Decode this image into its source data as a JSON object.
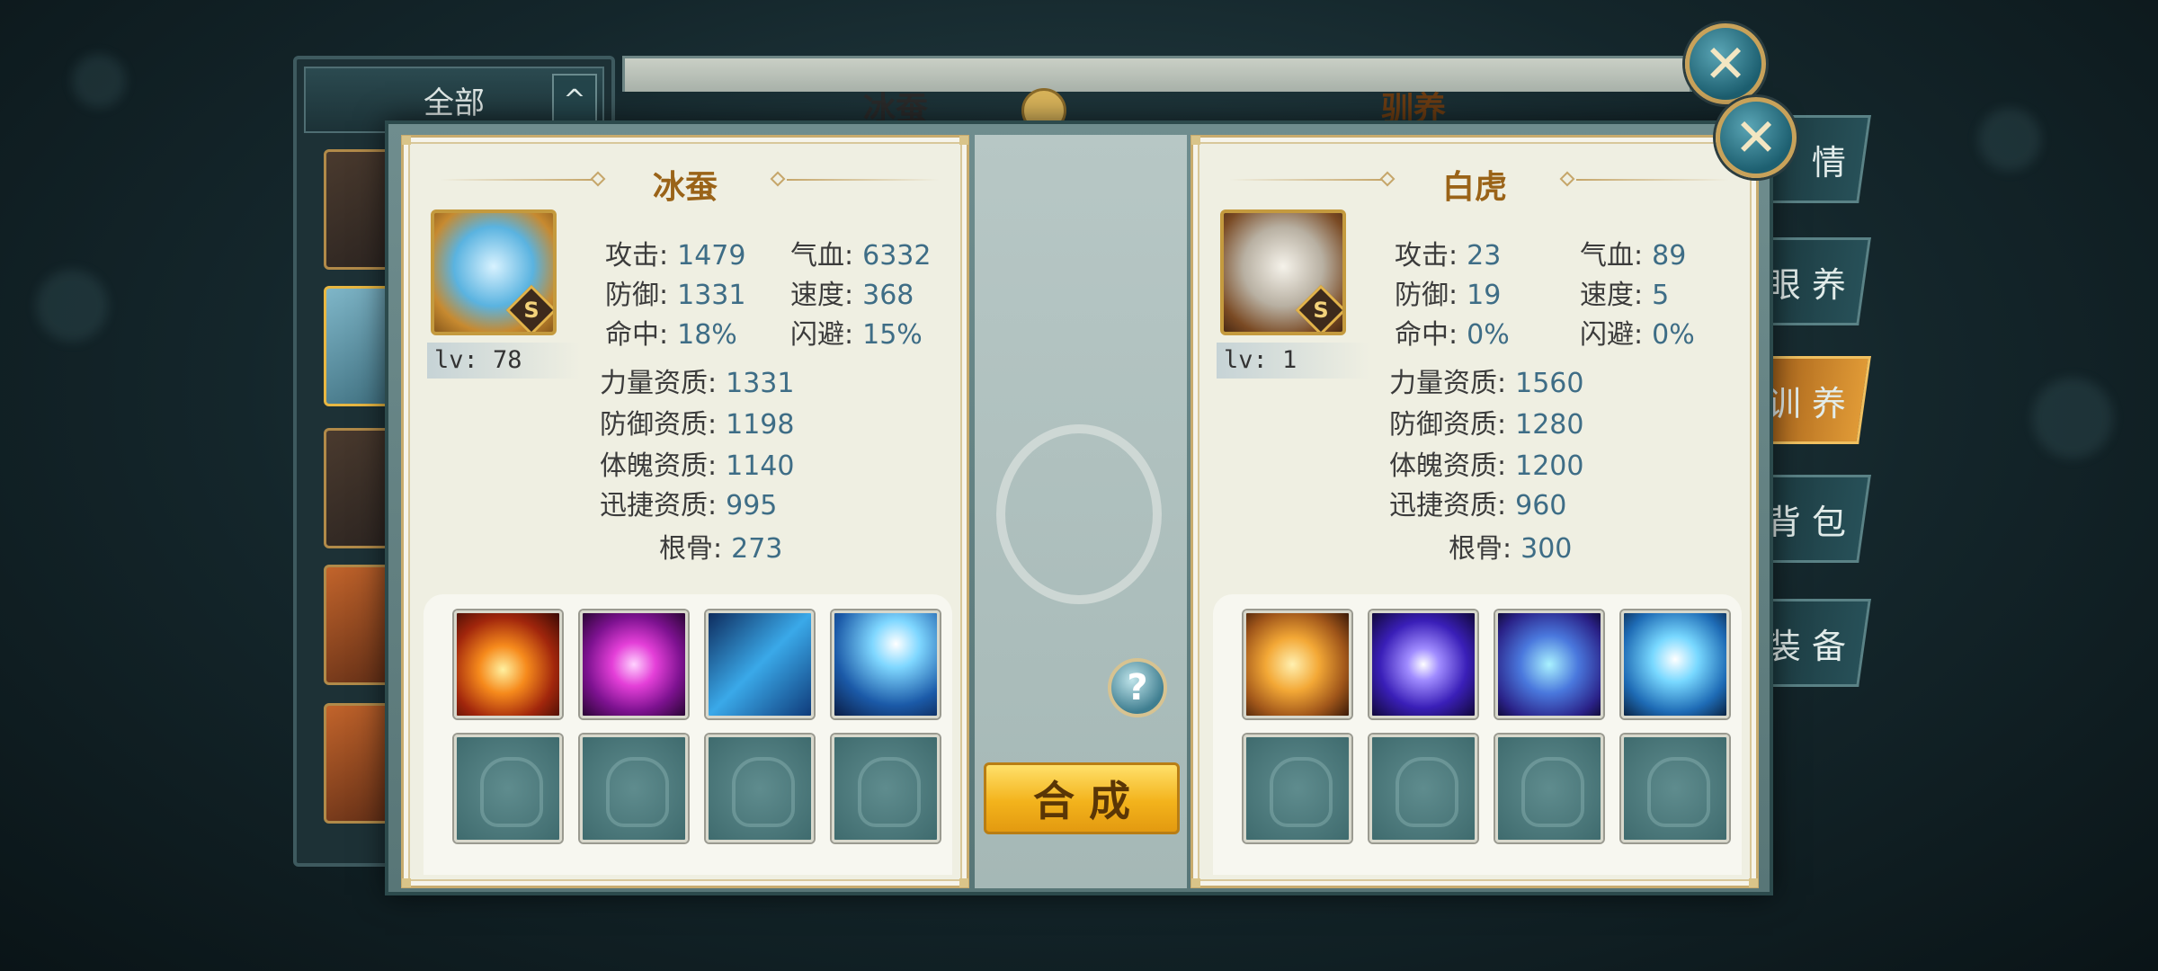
{
  "background": {
    "filter_label": "全部",
    "collapse_arrow": "^",
    "left_title": "冰蚕",
    "right_title": "驯养",
    "side_tabs": [
      "情",
      "眼 养",
      "训 养",
      "背 包",
      "装 备"
    ],
    "active_tab_index": 2
  },
  "dialog": {
    "close_symbol": "✕",
    "merge_label": "合成",
    "help_symbol": "?",
    "left_pet": {
      "name": "冰蚕",
      "grade": "S",
      "level_text": "lv: 78",
      "stats": {
        "attack_label": "攻击:",
        "attack": "1479",
        "hp_label": "气血:",
        "hp": "6332",
        "defense_label": "防御:",
        "defense": "1331",
        "speed_label": "速度:",
        "speed": "368",
        "hit_label": "命中:",
        "hit": "18%",
        "dodge_label": "闪避:",
        "dodge": "15%"
      },
      "aptitudes": {
        "str_label": "力量资质:",
        "str": "1331",
        "def_label": "防御资质:",
        "def": "1198",
        "con_label": "体魄资质:",
        "con": "1140",
        "agi_label": "迅捷资质:",
        "agi": "995",
        "bone_label": "根骨:",
        "bone": "273"
      },
      "skills": [
        "fire-phoenix-skill-icon",
        "pink-vortex-skill-icon",
        "ice-card-skill-icon",
        "lightning-skill-icon"
      ]
    },
    "right_pet": {
      "name": "白虎",
      "grade": "S",
      "level_text": "lv: 1",
      "stats": {
        "attack_label": "攻击:",
        "attack": "23",
        "hp_label": "气血:",
        "hp": "89",
        "defense_label": "防御:",
        "defense": "19",
        "speed_label": "速度:",
        "speed": "5",
        "hit_label": "命中:",
        "hit": "0%",
        "dodge_label": "闪避:",
        "dodge": "0%"
      },
      "aptitudes": {
        "str_label": "力量资质:",
        "str": "1560",
        "def_label": "防御资质:",
        "def": "1280",
        "con_label": "体魄资质:",
        "con": "1200",
        "agi_label": "迅捷资质:",
        "agi": "960",
        "bone_label": "根骨:",
        "bone": "300"
      },
      "skills": [
        "golden-tiger-skill-icon",
        "purple-orb-skill-icon",
        "shield-skill-icon",
        "water-heart-skill-icon"
      ]
    }
  },
  "colors": {
    "title_gold": "#9a6318",
    "value_blue": "#3e6d86",
    "button_gold": "#f3b31c"
  }
}
